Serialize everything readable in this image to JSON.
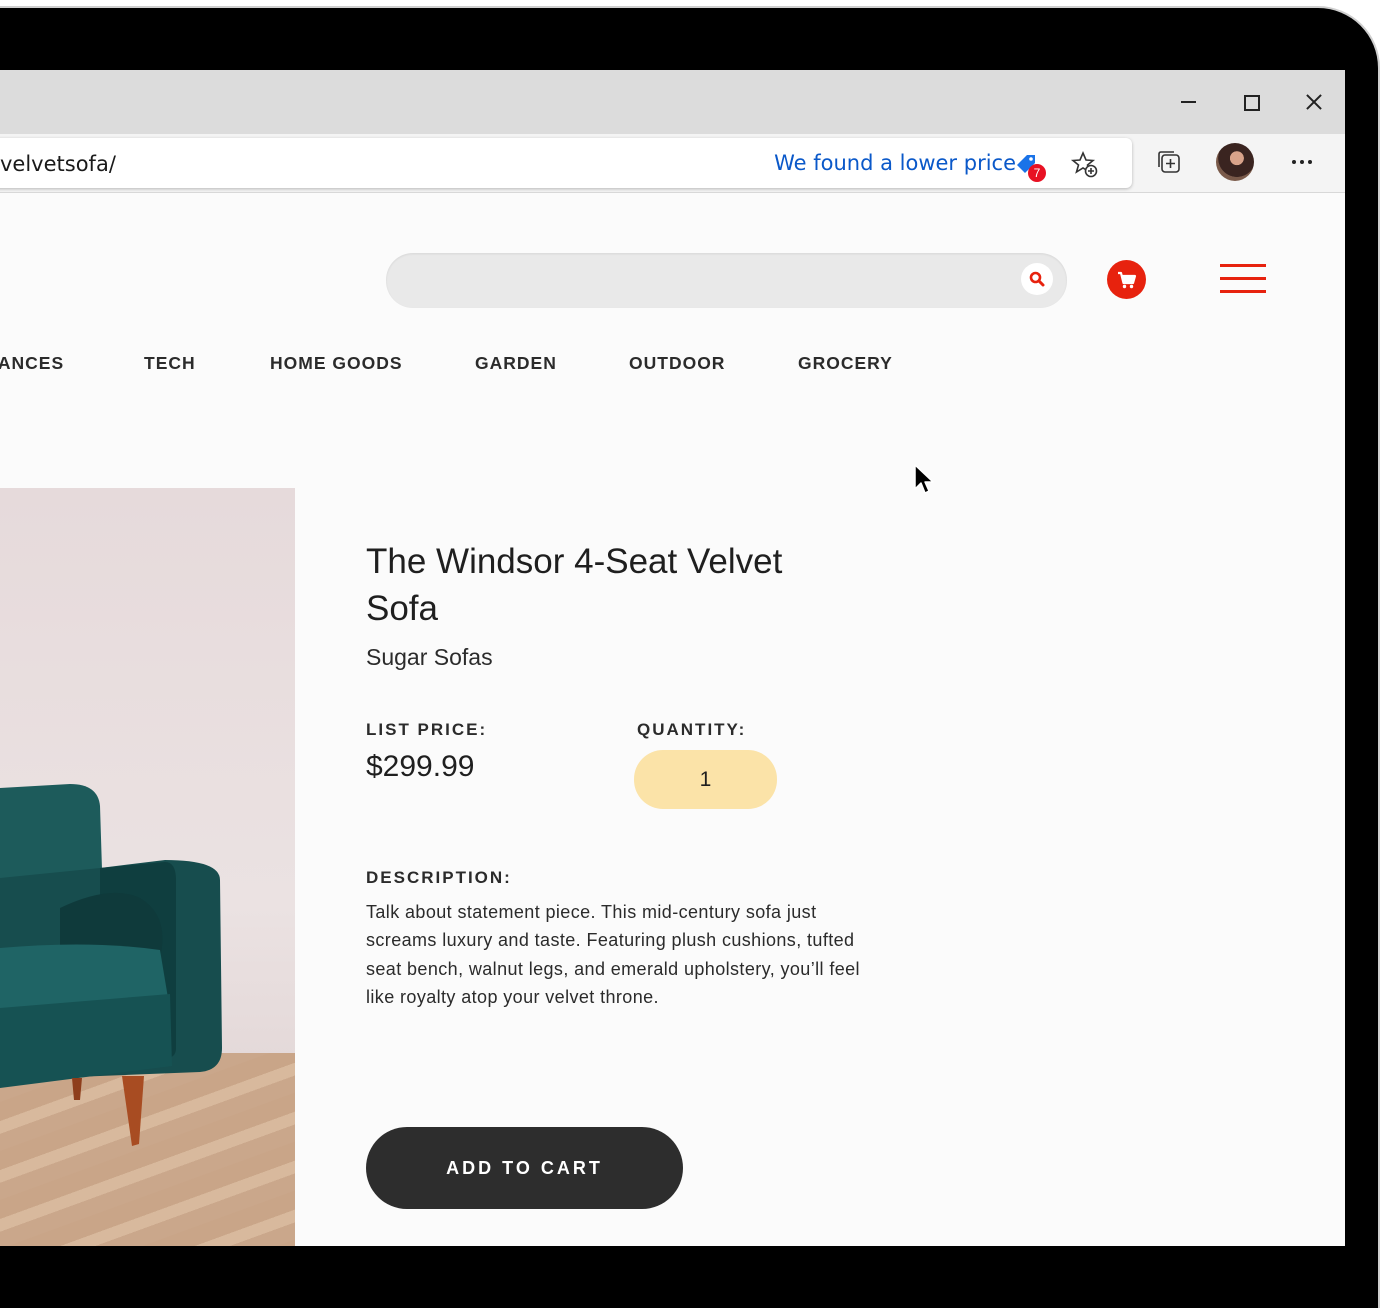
{
  "browser": {
    "url": "velvetsofa/",
    "price_alert": "We found a lower price",
    "coupon_count": "7"
  },
  "nav": {
    "items": [
      "IANCES",
      "TECH",
      "HOME GOODS",
      "GARDEN",
      "OUTDOOR",
      "GROCERY"
    ]
  },
  "product": {
    "title": "The Windsor 4-Seat Velvet Sofa",
    "brand": "Sugar Sofas",
    "list_price_label": "LIST PRICE:",
    "price": "$299.99",
    "quantity_label": "QUANTITY:",
    "quantity": "1",
    "description_label": "DESCRIPTION:",
    "description": "Talk about statement piece. This mid-century sofa just screams luxury and taste. Featuring plush cushions, tufted seat bench, walnut legs, and emerald upholstery, you’ll feel like royalty atop your velvet throne.",
    "add_to_cart": "ADD TO CART"
  },
  "colors": {
    "accent": "#e7220e",
    "quantity_bg": "#fbe3a8",
    "button_dark": "#2d2d2d",
    "sofa": "#1c5a5a"
  },
  "icons": [
    "tag-icon",
    "favorite-add-icon",
    "collections-icon",
    "more-icon",
    "search-icon",
    "cart-icon",
    "hamburger-menu-icon",
    "mouse-pointer-icon"
  ]
}
